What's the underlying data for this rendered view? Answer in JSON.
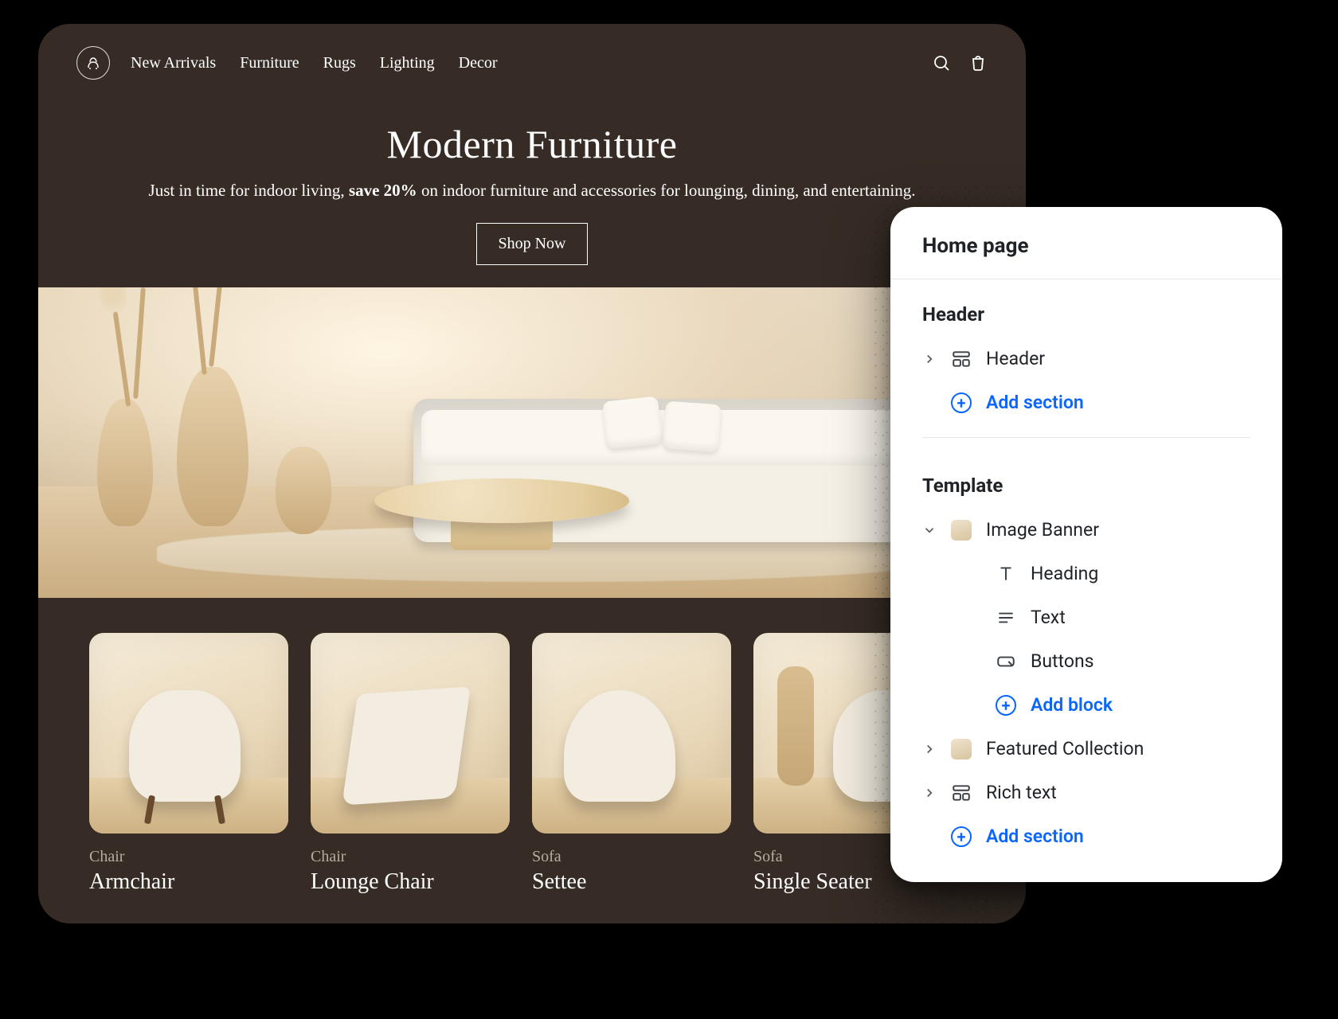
{
  "store": {
    "nav": [
      "New Arrivals",
      "Furniture",
      "Rugs",
      "Lighting",
      "Decor"
    ],
    "hero": {
      "title": "Modern Furniture",
      "text_pre": "Just in time for indoor living, ",
      "text_bold": "save 20%",
      "text_post": " on indoor furniture and accessories for lounging, dining, and entertaining.",
      "cta": "Shop Now"
    },
    "products": [
      {
        "category": "Chair",
        "name": "Armchair"
      },
      {
        "category": "Chair",
        "name": "Lounge Chair"
      },
      {
        "category": "Sofa",
        "name": "Settee"
      },
      {
        "category": "Sofa",
        "name": "Single Seater"
      }
    ]
  },
  "panel": {
    "title": "Home page",
    "groups": {
      "header_label": "Header",
      "template_label": "Template"
    },
    "header_section": "Header",
    "add_section": "Add section",
    "image_banner": "Image Banner",
    "blocks": {
      "heading": "Heading",
      "text": "Text",
      "buttons": "Buttons"
    },
    "add_block": "Add block",
    "featured_collection": "Featured Collection",
    "rich_text": "Rich text"
  }
}
